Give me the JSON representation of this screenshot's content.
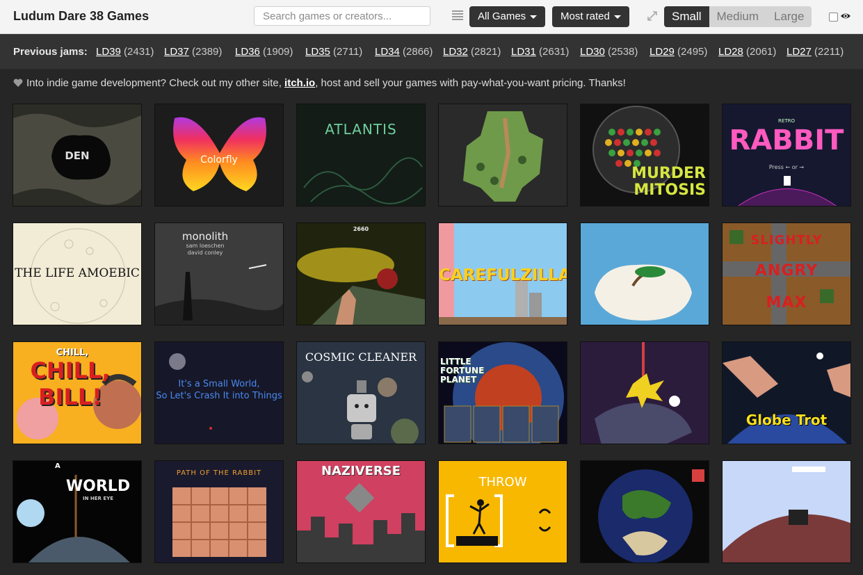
{
  "header": {
    "title": "Ludum Dare 38 Games",
    "search_placeholder": "Search games or creators...",
    "filter_label": "All Games",
    "sort_label": "Most rated",
    "sizes": [
      "Small",
      "Medium",
      "Large"
    ],
    "active_size": "Small"
  },
  "jams": {
    "label": "Previous jams:",
    "items": [
      {
        "name": "LD39",
        "count": "(2431)"
      },
      {
        "name": "LD37",
        "count": "(2389)"
      },
      {
        "name": "LD36",
        "count": "(1909)"
      },
      {
        "name": "LD35",
        "count": "(2711)"
      },
      {
        "name": "LD34",
        "count": "(2866)"
      },
      {
        "name": "LD32",
        "count": "(2821)"
      },
      {
        "name": "LD31",
        "count": "(2631)"
      },
      {
        "name": "LD30",
        "count": "(2538)"
      },
      {
        "name": "LD29",
        "count": "(2495)"
      },
      {
        "name": "LD28",
        "count": "(2061)"
      },
      {
        "name": "LD27",
        "count": "(2211)"
      }
    ]
  },
  "notice": {
    "before": "Into indie game development? Check out my other site,",
    "link": "itch.io",
    "after": ", host and sell your games with pay-what-you-want pricing. Thanks!"
  },
  "games": [
    {
      "title": "DEN"
    },
    {
      "title": "Colorfly"
    },
    {
      "title": "ATLANTIS"
    },
    {
      "title": ""
    },
    {
      "title": "MURDER MITOSIS"
    },
    {
      "title": "RABBIT",
      "sub": "Press ← or →",
      "tag": "RETRO"
    },
    {
      "title": "THE LIFE AMOEBIC"
    },
    {
      "title": "monolith",
      "sub": "sam loeschen",
      "sub2": "david conley"
    },
    {
      "title": "2660"
    },
    {
      "title": "CAREFULZILLA"
    },
    {
      "title": ""
    },
    {
      "title": "SLIGHTLY",
      "sub": "ANGRY",
      "sub2": "MAX"
    },
    {
      "title": "CHILL, BILL!"
    },
    {
      "title": "It's a Small World,",
      "sub": "So Let's Crash It into Things"
    },
    {
      "title": "COSMIC CLEANER"
    },
    {
      "title": "LITTLE FORTUNE PLANET"
    },
    {
      "title": ""
    },
    {
      "title": "Globe Trot"
    },
    {
      "title": "WORLD",
      "sub": "IN HER EYE",
      "tag": "A"
    },
    {
      "title": "PATH OF THE RABBIT"
    },
    {
      "title": "NAZIVERSE"
    },
    {
      "title": "THROW"
    },
    {
      "title": ""
    },
    {
      "title": ""
    }
  ]
}
